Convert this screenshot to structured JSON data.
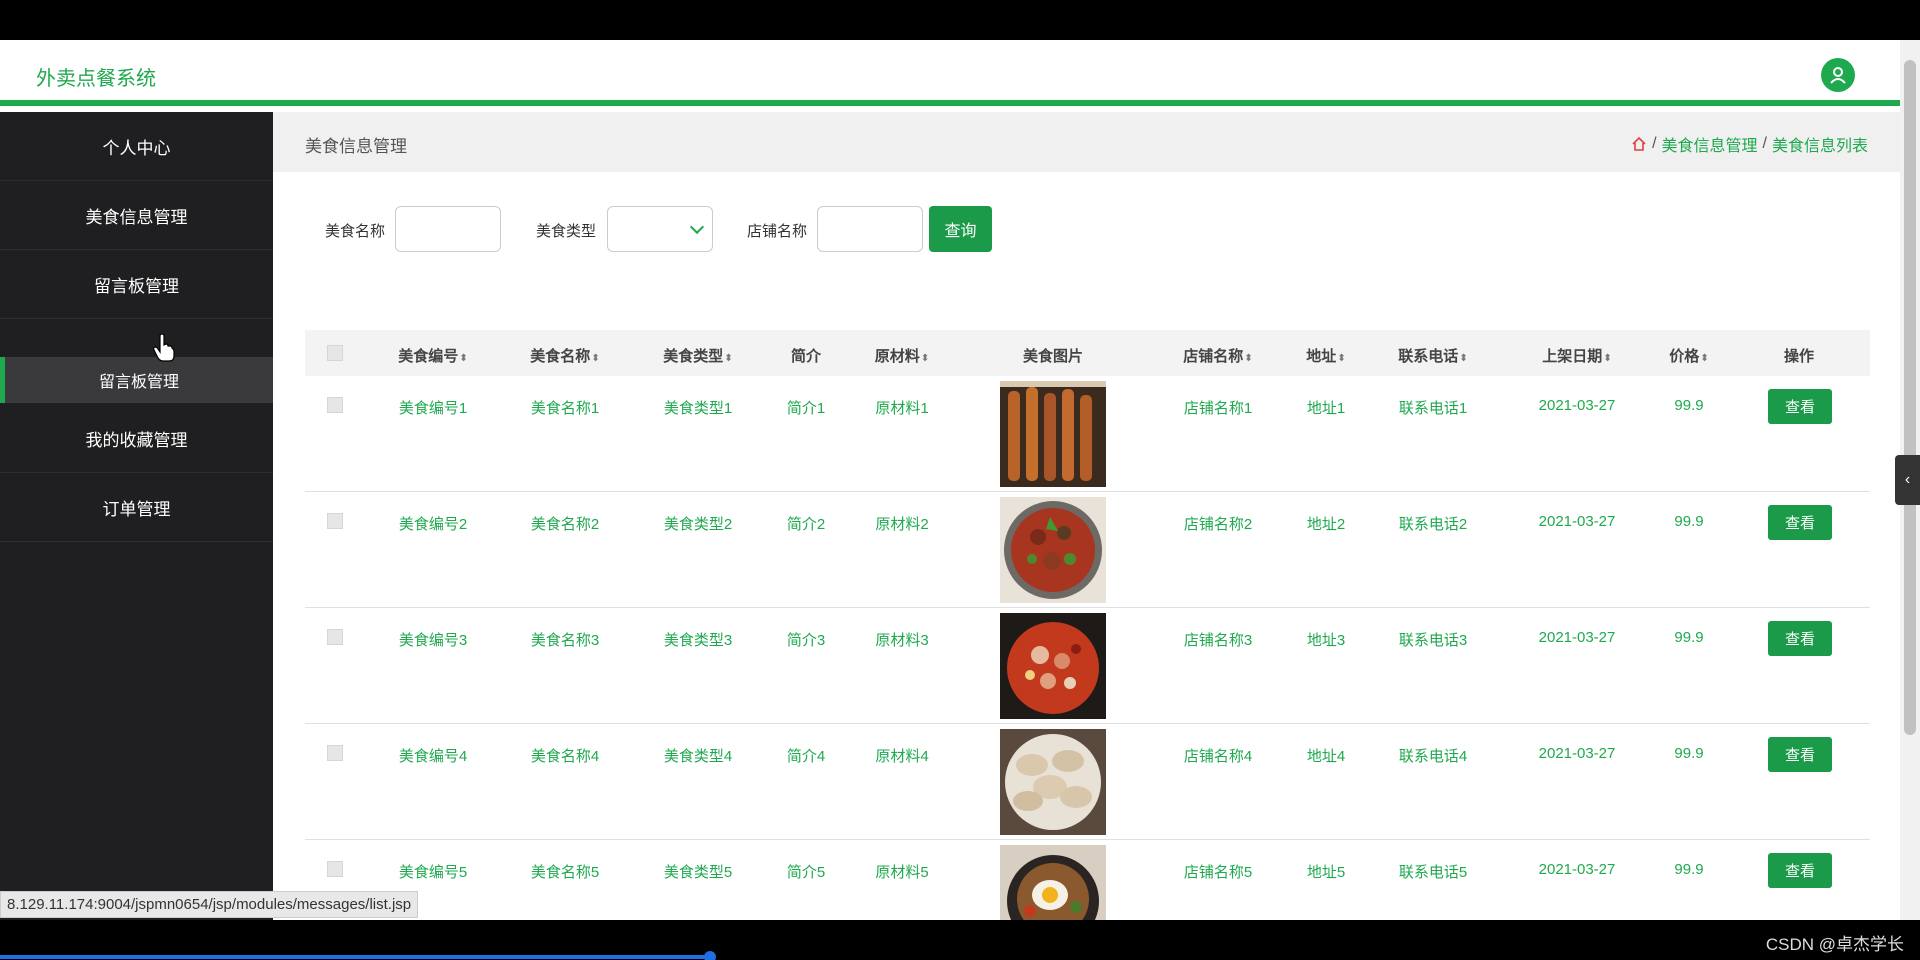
{
  "app": {
    "title": "外卖点餐系统",
    "accent": "#1fa94f",
    "avatar_icon": "user-icon"
  },
  "sidebar": {
    "items": [
      {
        "label": "个人中心",
        "active": false
      },
      {
        "label": "美食信息管理",
        "active": false
      },
      {
        "label": "留言板管理",
        "active": false
      },
      {
        "label": "留言板管理",
        "active": true
      },
      {
        "label": "我的收藏管理",
        "active": false
      },
      {
        "label": "订单管理",
        "active": false
      }
    ]
  },
  "breadcrumb": {
    "title": "美食信息管理",
    "home_icon": "home-icon",
    "sep": "/",
    "items": [
      "美食信息管理",
      "美食信息列表"
    ]
  },
  "search": {
    "name_label": "美食名称",
    "name_value": "",
    "type_label": "美食类型",
    "type_value": "",
    "shop_label": "店铺名称",
    "shop_value": "",
    "button": "查询"
  },
  "table": {
    "headers": [
      {
        "label": "美食编号",
        "sortable": true
      },
      {
        "label": "美食名称",
        "sortable": true
      },
      {
        "label": "美食类型",
        "sortable": true
      },
      {
        "label": "简介",
        "sortable": false
      },
      {
        "label": "原材料",
        "sortable": true
      },
      {
        "label": "美食图片",
        "sortable": false
      },
      {
        "label": "店铺名称",
        "sortable": true
      },
      {
        "label": "地址",
        "sortable": true
      },
      {
        "label": "联系电话",
        "sortable": true
      },
      {
        "label": "上架日期",
        "sortable": true
      },
      {
        "label": "价格",
        "sortable": true
      },
      {
        "label": "操作",
        "sortable": false
      }
    ],
    "sort_glyph": "⬍",
    "action_label": "查看",
    "rows": [
      {
        "id": "美食编号1",
        "name": "美食名称1",
        "type": "美食类型1",
        "intro": "简介1",
        "material": "原材料1",
        "shop": "店铺名称1",
        "address": "地址1",
        "phone": "联系电话1",
        "date": "2021-03-27",
        "price": "99.9",
        "image": "grilled-skewers"
      },
      {
        "id": "美食编号2",
        "name": "美食名称2",
        "type": "美食类型2",
        "intro": "简介2",
        "material": "原材料2",
        "shop": "店铺名称2",
        "address": "地址2",
        "phone": "联系电话2",
        "date": "2021-03-27",
        "price": "99.9",
        "image": "spicy-meat-bowl"
      },
      {
        "id": "美食编号3",
        "name": "美食名称3",
        "type": "美食类型3",
        "intro": "简介3",
        "material": "原材料3",
        "shop": "店铺名称3",
        "address": "地址3",
        "phone": "联系电话3",
        "date": "2021-03-27",
        "price": "99.9",
        "image": "pepper-crayfish-pot"
      },
      {
        "id": "美食编号4",
        "name": "美食名称4",
        "type": "美食类型4",
        "intro": "简介4",
        "material": "原材料4",
        "shop": "店铺名称4",
        "address": "地址4",
        "phone": "联系电话4",
        "date": "2021-03-27",
        "price": "99.9",
        "image": "dumplings-plate"
      },
      {
        "id": "美食编号5",
        "name": "美食名称5",
        "type": "美食类型5",
        "intro": "简介5",
        "material": "原材料5",
        "shop": "店铺名称5",
        "address": "地址5",
        "phone": "联系电话5",
        "date": "2021-03-27",
        "price": "99.9",
        "image": "bibimbap-egg"
      }
    ]
  },
  "status": {
    "url": "8.129.11.174:9004/jspmn0654/jsp/modules/messages/list.jsp",
    "watermark": "CSDN @卓杰学长"
  }
}
